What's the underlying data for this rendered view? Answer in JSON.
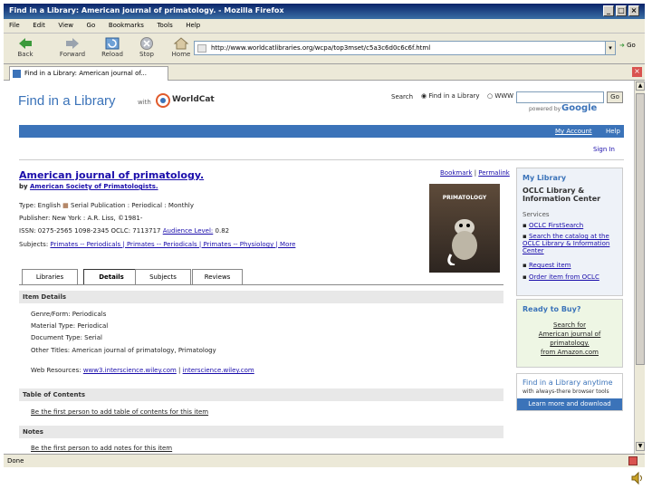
{
  "window": {
    "title": "Find in a Library: American journal of primatology. - Mozilla Firefox"
  },
  "menu": [
    "File",
    "Edit",
    "View",
    "Go",
    "Bookmarks",
    "Tools",
    "Help"
  ],
  "toolbar": {
    "back": "Back",
    "forward": "Forward",
    "reload": "Reload",
    "stop": "Stop",
    "home": "Home",
    "url": "http://www.worldcatlibraries.org/wcpa/top3mset/c5a3c6d0c6c6f.html",
    "go": "Go"
  },
  "browser_tab": {
    "label": "Find in a Library: American journal of..."
  },
  "status": {
    "text": "Done"
  },
  "site": {
    "logo_text": "Find in a Library",
    "with": "with",
    "worldcat": "WorldCat",
    "search_label": "Search",
    "radio_library": "Find in a Library",
    "radio_www": "WWW",
    "go_button": "Go",
    "powered_by": "powered by",
    "google": "Google",
    "my_account": "My Account",
    "help": "Help",
    "sign_in": "Sign In"
  },
  "record": {
    "title": "American journal of primatology.",
    "by_label": "by",
    "author": "American Society of Primatologists.",
    "type_line": "Type: English",
    "serial_pub": "Serial Publication : Periodical : Monthly",
    "publisher": "Publisher: New York : A.R. Liss, ©1981-",
    "issn": "ISSN: 0275-2565 1098-2345    OCLC: 7113717",
    "audience_label": "Audience Level:",
    "audience_value": "0.82",
    "subjects_label": "Subjects:",
    "subjects": "Primates -- Periodicals | Primates -- Periodicals | Primates -- Physiology | More",
    "bookmark": "Bookmark",
    "permalink": "Permalink",
    "cover_text": "PRIMATOLOGY"
  },
  "tabs": [
    "Libraries",
    "Details",
    "Subjects",
    "Reviews"
  ],
  "details": {
    "item_details": "Item Details",
    "genre": "Genre/Form: Periodicals",
    "material": "Material Type: Periodical",
    "doc_type": "Document Type: Serial",
    "other_titles": "Other Titles: American journal of primatology, Primatology",
    "web_label": "Web Resources:",
    "web_link1": "www3.interscience.wiley.com",
    "web_link2": "interscience.wiley.com",
    "toc_head": "Table of Contents",
    "toc_link": "Be the first person to add table of contents for this item",
    "notes_head": "Notes",
    "notes_link": "Be the first person to add notes for this item"
  },
  "sidebar": {
    "my_library": "My Library",
    "org_name": "OCLC Library & Information Center",
    "services": "Services",
    "service1": "OCLC FirstSearch",
    "service2": "Search the catalog at the OCLC Library & Information Center",
    "service3": "Request item",
    "service4": "Order item from OCLC",
    "ready_head": "Ready to Buy?",
    "ready_link1": "Search for",
    "ready_link2": "American journal of",
    "ready_link3": "primatology.",
    "ready_link4": "from Amazon.com",
    "promo1": "Find in a Library anytime",
    "promo2": "with always-there browser tools",
    "promo3": "Learn more and download"
  }
}
